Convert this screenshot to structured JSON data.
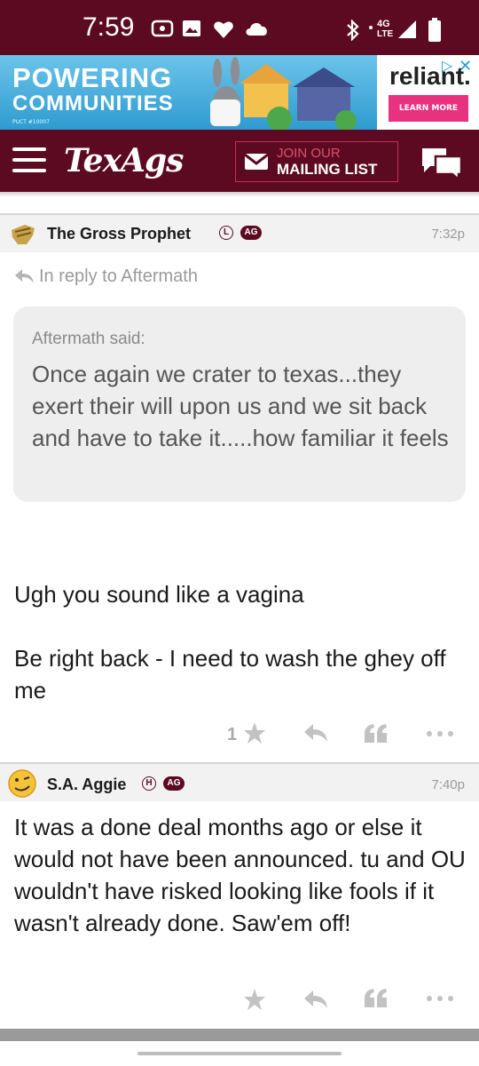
{
  "status_bar": {
    "time": "7:59"
  },
  "ad": {
    "headline_1": "POWERING",
    "headline_2": "COMMUNITIES",
    "fine_print": "PUCT #10007",
    "brand": "reliant.",
    "cta": "LEARN MORE"
  },
  "header": {
    "logo": "TexAgs",
    "mailing_line1": "JOIN OUR",
    "mailing_line2": "MAILING LIST"
  },
  "posts": [
    {
      "author": "The Gross Prophet",
      "badge": "L",
      "affiliation": "AG",
      "time": "7:32p",
      "reply_to": "In reply to Aftermath",
      "quote_author": "Aftermath said:",
      "quote_text": "Once again we crater to texas...they exert their will upon us and we sit back and have to take it.....how familiar it feels",
      "body_line1": "Ugh you sound like a vagina",
      "body_line2": "Be right back - I need to wash the ghey off me",
      "star_count": "1"
    },
    {
      "author": "S.A. Aggie",
      "badge": "H",
      "affiliation": "AG",
      "time": "7:40p",
      "body": "It was a done deal months ago or else it would not have been announced. tu and OU wouldn't have risked looking like fools if it wasn't already done. Saw'em off!",
      "star_count": ""
    }
  ],
  "colors": {
    "brand": "#5c0a22",
    "ad_pink": "#e8317f",
    "ad_blue": "#3fa9d8"
  }
}
